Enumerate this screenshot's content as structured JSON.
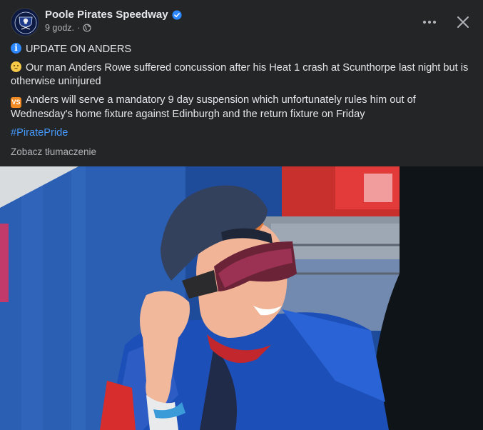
{
  "page": {
    "name": "Poole Pirates Speedway",
    "time": "9 godz.",
    "separator": "·"
  },
  "post": {
    "line1_text": "UPDATE ON ANDERS",
    "line2_text": "Our man Anders Rowe suffered concussion after his Heat 1 crash at Scunthorpe last night but is otherwise uninjured",
    "line3_text": "Anders will serve a mandatory 9 day suspension which unfortunately rules him out of Wednesday's home fixture against Edinburgh and the return fixture on Friday",
    "hashtag": "#PiratePride",
    "translate_label": "Zobacz tłumaczenie",
    "vs_emoji_label": "VS"
  },
  "icons": {
    "verified": "verified-badge-icon",
    "privacy": "globe-icon",
    "more": "more-options-icon",
    "close": "close-icon",
    "info": "info-emoji-icon",
    "face": "worried-face-emoji-icon",
    "vs": "vs-emoji-icon"
  },
  "colors": {
    "background": "#242526",
    "text": "#e4e6eb",
    "secondary_text": "#b0b3b8",
    "link": "#4599ff",
    "verified": "#2d88ff"
  }
}
